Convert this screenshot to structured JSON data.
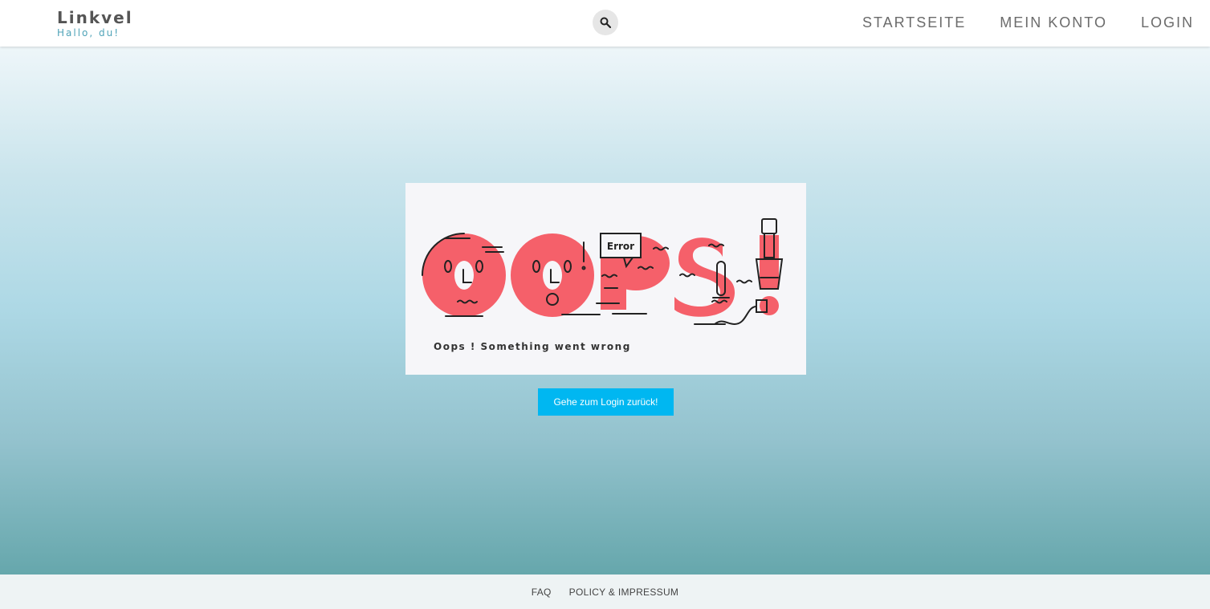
{
  "header": {
    "brand": "Linkvel",
    "tagline": "Hallo, du!",
    "search_icon": "search-icon",
    "nav": [
      {
        "label": "STARTSEITE"
      },
      {
        "label": "MEIN KONTO"
      },
      {
        "label": "LOGIN"
      }
    ]
  },
  "main": {
    "illustration": {
      "headline": "OOPS!",
      "bubble_text": "Error",
      "caption": "Oops ! Something went wrong"
    },
    "back_button": "Gehe zum Login zurück!"
  },
  "footer": {
    "links": [
      {
        "label": "FAQ"
      },
      {
        "label": "POLICY & IMPRESSUM"
      }
    ]
  },
  "colors": {
    "accent_button": "#00b7f1",
    "oops_letters": "#f5606a",
    "brand_tagline": "#4fa3b8"
  }
}
